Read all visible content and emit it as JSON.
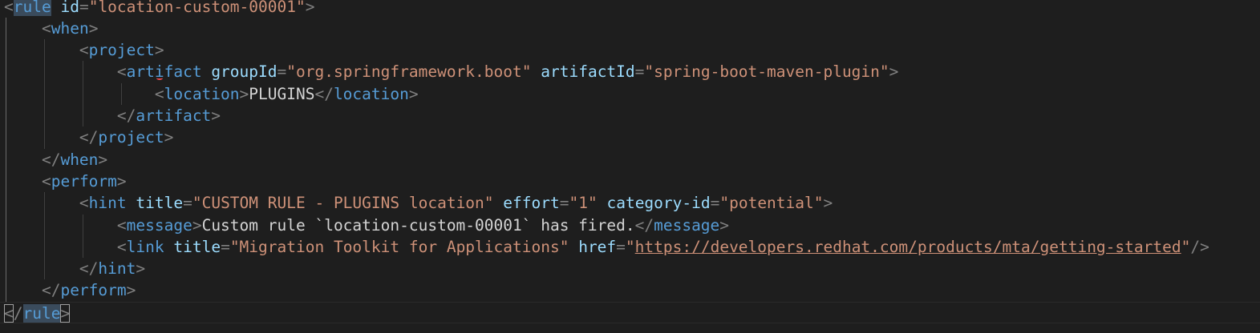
{
  "editor": {
    "language": "xml",
    "lines": [
      {
        "tokens": [
          [
            "p",
            "<"
          ],
          [
            "tag",
            "rule"
          ],
          [
            "txt",
            " "
          ],
          [
            "attr",
            "id"
          ],
          [
            "p",
            "="
          ],
          [
            "str",
            "\"location-custom-00001\""
          ],
          [
            "p",
            ">"
          ]
        ]
      },
      {
        "tokens": [
          [
            "txt",
            "    "
          ],
          [
            "p",
            "<"
          ],
          [
            "tag",
            "when"
          ],
          [
            "p",
            ">"
          ]
        ]
      },
      {
        "tokens": [
          [
            "txt",
            "        "
          ],
          [
            "p",
            "<"
          ],
          [
            "tag",
            "project"
          ],
          [
            "p",
            ">"
          ]
        ]
      },
      {
        "tokens": [
          [
            "txt",
            "            "
          ],
          [
            "p",
            "<"
          ],
          [
            "tag",
            "artifact"
          ],
          [
            "txt",
            " "
          ],
          [
            "attr",
            "groupId"
          ],
          [
            "p",
            "="
          ],
          [
            "str",
            "\"org.springframework.boot\""
          ],
          [
            "txt",
            " "
          ],
          [
            "attr",
            "artifactId"
          ],
          [
            "p",
            "="
          ],
          [
            "str",
            "\"spring-boot-maven-plugin\""
          ],
          [
            "p",
            ">"
          ]
        ]
      },
      {
        "tokens": [
          [
            "txt",
            "                "
          ],
          [
            "p",
            "<"
          ],
          [
            "tag",
            "location"
          ],
          [
            "p",
            ">"
          ],
          [
            "txt",
            "PLUGINS"
          ],
          [
            "p",
            "</"
          ],
          [
            "tag",
            "location"
          ],
          [
            "p",
            ">"
          ]
        ]
      },
      {
        "tokens": [
          [
            "txt",
            "            "
          ],
          [
            "p",
            "</"
          ],
          [
            "tag",
            "artifact"
          ],
          [
            "p",
            ">"
          ]
        ]
      },
      {
        "tokens": [
          [
            "txt",
            "        "
          ],
          [
            "p",
            "</"
          ],
          [
            "tag",
            "project"
          ],
          [
            "p",
            ">"
          ]
        ]
      },
      {
        "tokens": [
          [
            "txt",
            "    "
          ],
          [
            "p",
            "</"
          ],
          [
            "tag",
            "when"
          ],
          [
            "p",
            ">"
          ]
        ]
      },
      {
        "tokens": [
          [
            "txt",
            "    "
          ],
          [
            "p",
            "<"
          ],
          [
            "tag",
            "perform"
          ],
          [
            "p",
            ">"
          ]
        ]
      },
      {
        "tokens": [
          [
            "txt",
            "        "
          ],
          [
            "p",
            "<"
          ],
          [
            "tag",
            "hint"
          ],
          [
            "txt",
            " "
          ],
          [
            "attr",
            "title"
          ],
          [
            "p",
            "="
          ],
          [
            "str",
            "\"CUSTOM RULE - PLUGINS location\""
          ],
          [
            "txt",
            " "
          ],
          [
            "attr",
            "effort"
          ],
          [
            "p",
            "="
          ],
          [
            "str",
            "\"1\""
          ],
          [
            "txt",
            " "
          ],
          [
            "attr",
            "category-id"
          ],
          [
            "p",
            "="
          ],
          [
            "str",
            "\"potential\""
          ],
          [
            "p",
            ">"
          ]
        ]
      },
      {
        "tokens": [
          [
            "txt",
            "            "
          ],
          [
            "p",
            "<"
          ],
          [
            "tag",
            "message"
          ],
          [
            "p",
            ">"
          ],
          [
            "txt",
            "Custom rule `location-custom-00001` has fired."
          ],
          [
            "p",
            "</"
          ],
          [
            "tag",
            "message"
          ],
          [
            "p",
            ">"
          ]
        ]
      },
      {
        "tokens": [
          [
            "txt",
            "            "
          ],
          [
            "p",
            "<"
          ],
          [
            "tag",
            "link"
          ],
          [
            "txt",
            " "
          ],
          [
            "attr",
            "title"
          ],
          [
            "p",
            "="
          ],
          [
            "str",
            "\"Migration Toolkit for Applications\""
          ],
          [
            "txt",
            " "
          ],
          [
            "attr",
            "href"
          ],
          [
            "p",
            "="
          ],
          [
            "str",
            "\""
          ],
          [
            "str link",
            "https://developers.redhat.com/products/mta/getting-started"
          ],
          [
            "str",
            "\""
          ],
          [
            "p",
            "/>"
          ]
        ]
      },
      {
        "tokens": [
          [
            "txt",
            "        "
          ],
          [
            "p",
            "</"
          ],
          [
            "tag",
            "hint"
          ],
          [
            "p",
            ">"
          ]
        ]
      },
      {
        "tokens": [
          [
            "txt",
            "    "
          ],
          [
            "p",
            "</"
          ],
          [
            "tag",
            "perform"
          ],
          [
            "p",
            ">"
          ]
        ]
      },
      {
        "tokens": [
          [
            "p bracket",
            "<"
          ],
          [
            "p",
            "/"
          ],
          [
            "tag hl",
            "rule"
          ],
          [
            "p bracket",
            ">"
          ]
        ]
      }
    ]
  }
}
